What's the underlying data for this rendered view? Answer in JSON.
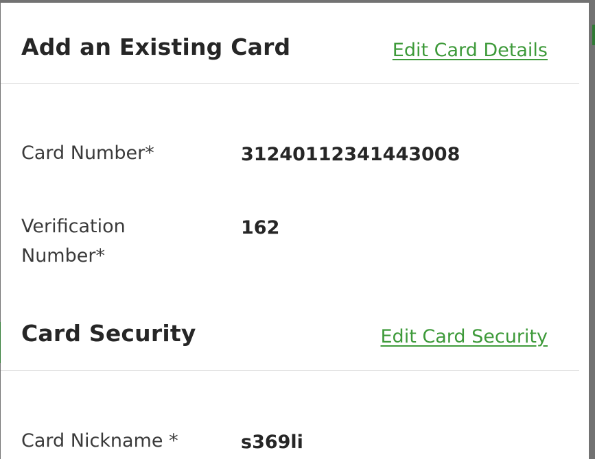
{
  "existing_card": {
    "title": "Add an Existing Card",
    "edit_link": "Edit Card Details",
    "fields": [
      {
        "label": "Card Number*",
        "value": "31240112341443008"
      },
      {
        "label": "Verification Number*",
        "value": "162"
      }
    ]
  },
  "card_security": {
    "title": "Card Security",
    "edit_link": "Edit Card Security",
    "fields": [
      {
        "label": "Card Nickname *",
        "value": "s369li"
      }
    ]
  },
  "colors": {
    "link_green": "#3e9a3a",
    "heading_text": "#262626",
    "backdrop": "#727272"
  }
}
